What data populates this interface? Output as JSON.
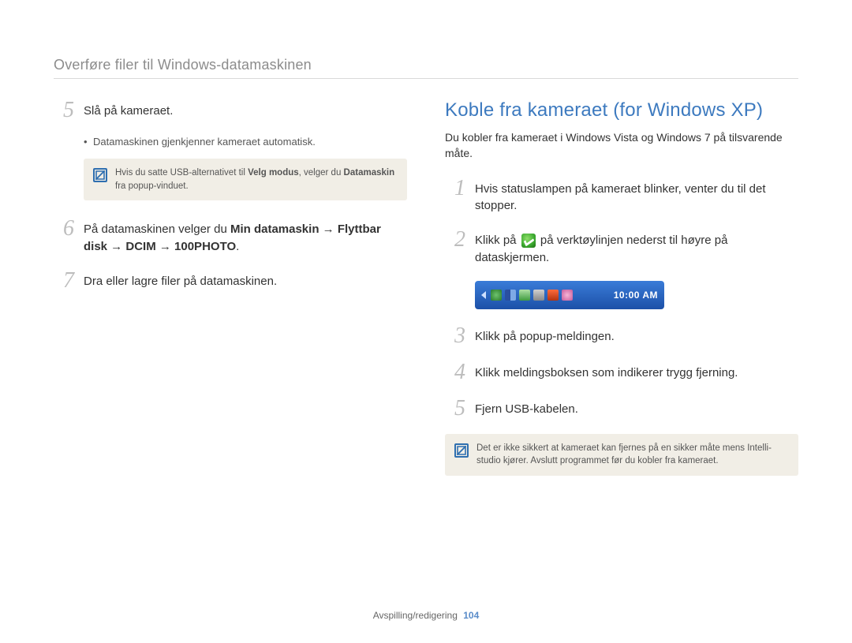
{
  "breadcrumb": "Overføre filer til Windows-datamaskinen",
  "left": {
    "step5": {
      "num": "5",
      "text": "Slå på kameraet.",
      "bullet": "Datamaskinen gjenkjenner kameraet automatisk."
    },
    "note1": {
      "a": "Hvis du satte USB-alternativet til ",
      "b": "Velg modus",
      "c": ", velger du ",
      "d": "Datamaskin",
      "e": " fra popup-vinduet."
    },
    "step6": {
      "num": "6",
      "a": "På datamaskinen velger du ",
      "b": "Min datamaskin",
      "c": " → ",
      "d": "Flyttbar disk",
      "e": " → ",
      "f": "DCIM",
      "g": " → ",
      "h": "100PHOTO",
      "i": "."
    },
    "step7": {
      "num": "7",
      "text": "Dra eller lagre filer på datamaskinen."
    }
  },
  "right": {
    "title": "Koble fra kameraet (for Windows XP)",
    "intro": "Du kobler fra kameraet i Windows Vista og Windows 7 på tilsvarende måte.",
    "step1": {
      "num": "1",
      "text": "Hvis statuslampen på kameraet blinker, venter du til det stopper."
    },
    "step2": {
      "num": "2",
      "a": "Klikk på ",
      "b": " på verktøylinjen nederst til høyre på dataskjermen."
    },
    "taskbar_time": "10:00 AM",
    "step3": {
      "num": "3",
      "text": "Klikk på popup-meldingen."
    },
    "step4": {
      "num": "4",
      "text": "Klikk meldingsboksen som indikerer trygg fjerning."
    },
    "step5": {
      "num": "5",
      "text": "Fjern USB-kabelen."
    },
    "note2": "Det er ikke sikkert at kameraet kan fjernes på en sikker måte mens Intelli-studio kjører. Avslutt programmet før du kobler fra kameraet."
  },
  "footer": {
    "section": "Avspilling/redigering",
    "page": "104"
  }
}
